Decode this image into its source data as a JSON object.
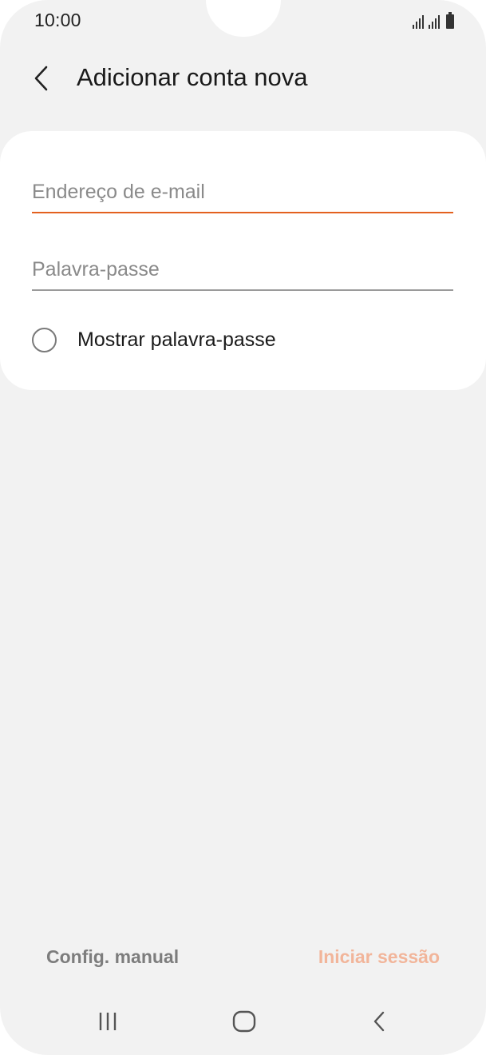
{
  "status_bar": {
    "time": "10:00",
    "icons": [
      "signal-sim1-icon",
      "signal-sim2-icon",
      "battery-icon"
    ]
  },
  "header": {
    "back_icon": "chevron-left-icon",
    "title": "Adicionar conta nova"
  },
  "form": {
    "email": {
      "value": "",
      "placeholder": "Endereço de e-mail",
      "focused": true
    },
    "password": {
      "value": "",
      "placeholder": "Palavra-passe"
    },
    "show_password": {
      "label": "Mostrar palavra-passe",
      "checked": false
    }
  },
  "actions": {
    "manual_label": "Config. manual",
    "signin_label": "Iniciar sessão"
  },
  "nav_bar": {
    "icons": [
      "recents-icon",
      "home-icon",
      "back-icon"
    ]
  },
  "colors": {
    "accent": "#e3611f",
    "accent_disabled": "#f2b59a",
    "background": "#f2f2f2",
    "card": "#ffffff"
  }
}
